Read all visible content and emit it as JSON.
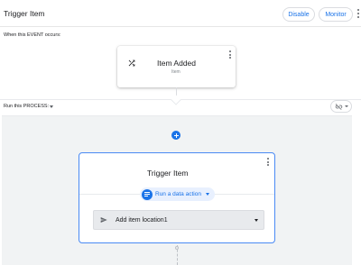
{
  "header": {
    "title": "Trigger Item",
    "disable_label": "Disable",
    "monitor_label": "Monitor"
  },
  "event_section": {
    "label": "When this EVENT occurs:",
    "card": {
      "title": "Item Added",
      "subtitle": "Item",
      "icon": "shuffle-icon"
    }
  },
  "process_section": {
    "label": "Run this PROCESS:",
    "toggle_icon": "link-off-icon"
  },
  "step": {
    "title": "Trigger Item",
    "action_type": "Run a data action",
    "action_name": "Add item location1",
    "action_icon": "send-icon"
  },
  "colors": {
    "accent": "#1a73e8",
    "step_border": "#4a8af4",
    "canvas_bg": "#f1f3f4"
  }
}
